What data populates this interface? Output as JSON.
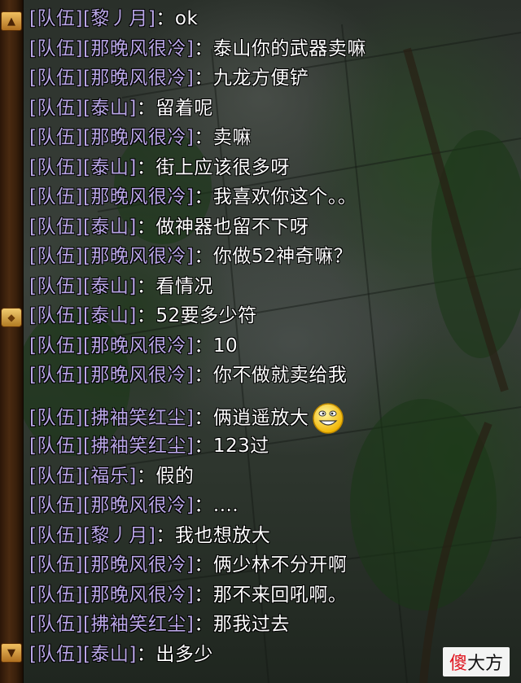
{
  "chat": {
    "messages": [
      {
        "channel": "[队伍]",
        "name": "[黎丿月]",
        "colon": "：",
        "text": "ok"
      },
      {
        "channel": "[队伍]",
        "name": "[那晚风很冷]",
        "colon": "：",
        "text": "泰山你的武器卖嘛"
      },
      {
        "channel": "[队伍]",
        "name": "[那晚风很冷]",
        "colon": "：",
        "text": "九龙方便铲"
      },
      {
        "channel": "[队伍]",
        "name": "[泰山]",
        "colon": "：",
        "text": "留着呢"
      },
      {
        "channel": "[队伍]",
        "name": "[那晚风很冷]",
        "colon": "：",
        "text": "卖嘛"
      },
      {
        "channel": "[队伍]",
        "name": "[泰山]",
        "colon": "：",
        "text": "街上应该很多呀"
      },
      {
        "channel": "[队伍]",
        "name": "[那晚风很冷]",
        "colon": "：",
        "text": "我喜欢你这个。。"
      },
      {
        "channel": "[队伍]",
        "name": "[泰山]",
        "colon": "：",
        "text": "做神器也留不下呀"
      },
      {
        "channel": "[队伍]",
        "name": "[那晚风很冷]",
        "colon": "：",
        "text": "你做52神奇嘛？"
      },
      {
        "channel": "[队伍]",
        "name": "[泰山]",
        "colon": "：",
        "text": "看情况"
      },
      {
        "channel": "[队伍]",
        "name": "[泰山]",
        "colon": "：",
        "text": "52要多少符"
      },
      {
        "channel": "[队伍]",
        "name": "[那晚风很冷]",
        "colon": "：",
        "text": "10"
      },
      {
        "channel": "[队伍]",
        "name": "[那晚风很冷]",
        "colon": "：",
        "text": "你不做就卖给我"
      },
      {
        "channel": "[队伍]",
        "name": "[拂袖笑红尘]",
        "colon": "：",
        "text": "俩逍遥放大"
      },
      {
        "channel": "[队伍]",
        "name": "[拂袖笑红尘]",
        "colon": "：",
        "text": "123过"
      },
      {
        "channel": "[队伍]",
        "name": "[福乐]",
        "colon": "：",
        "text": "假的"
      },
      {
        "channel": "[队伍]",
        "name": "[那晚风很冷]",
        "colon": "：",
        "text": "...."
      },
      {
        "channel": "[队伍]",
        "name": "[黎丿月]",
        "colon": "：",
        "text": "我也想放大"
      },
      {
        "channel": "[队伍]",
        "name": "[那晚风很冷]",
        "colon": "：",
        "text": "俩少林不分开啊"
      },
      {
        "channel": "[队伍]",
        "name": "[那晚风很冷]",
        "colon": "：",
        "text": "那不来回吼啊。"
      },
      {
        "channel": "[队伍]",
        "name": "[拂袖笑红尘]",
        "colon": "：",
        "text": "那我过去"
      },
      {
        "channel": "[队伍]",
        "name": "[泰山]",
        "colon": "：",
        "text": "出多少"
      }
    ],
    "smiley_icon": "grin-emoticon-icon"
  },
  "scrollbar": {
    "up_icon": "scroll-up-icon",
    "down_icon": "scroll-down-icon",
    "thumb_icon": "scroll-thumb-icon"
  },
  "watermark": {
    "red_part": "傻",
    "black_part": "大方"
  },
  "colors": {
    "channel_tag": "#b9a6e6",
    "message_text": "#ffffff",
    "rail": "#4a2a10",
    "rail_button": "#d89a40"
  }
}
